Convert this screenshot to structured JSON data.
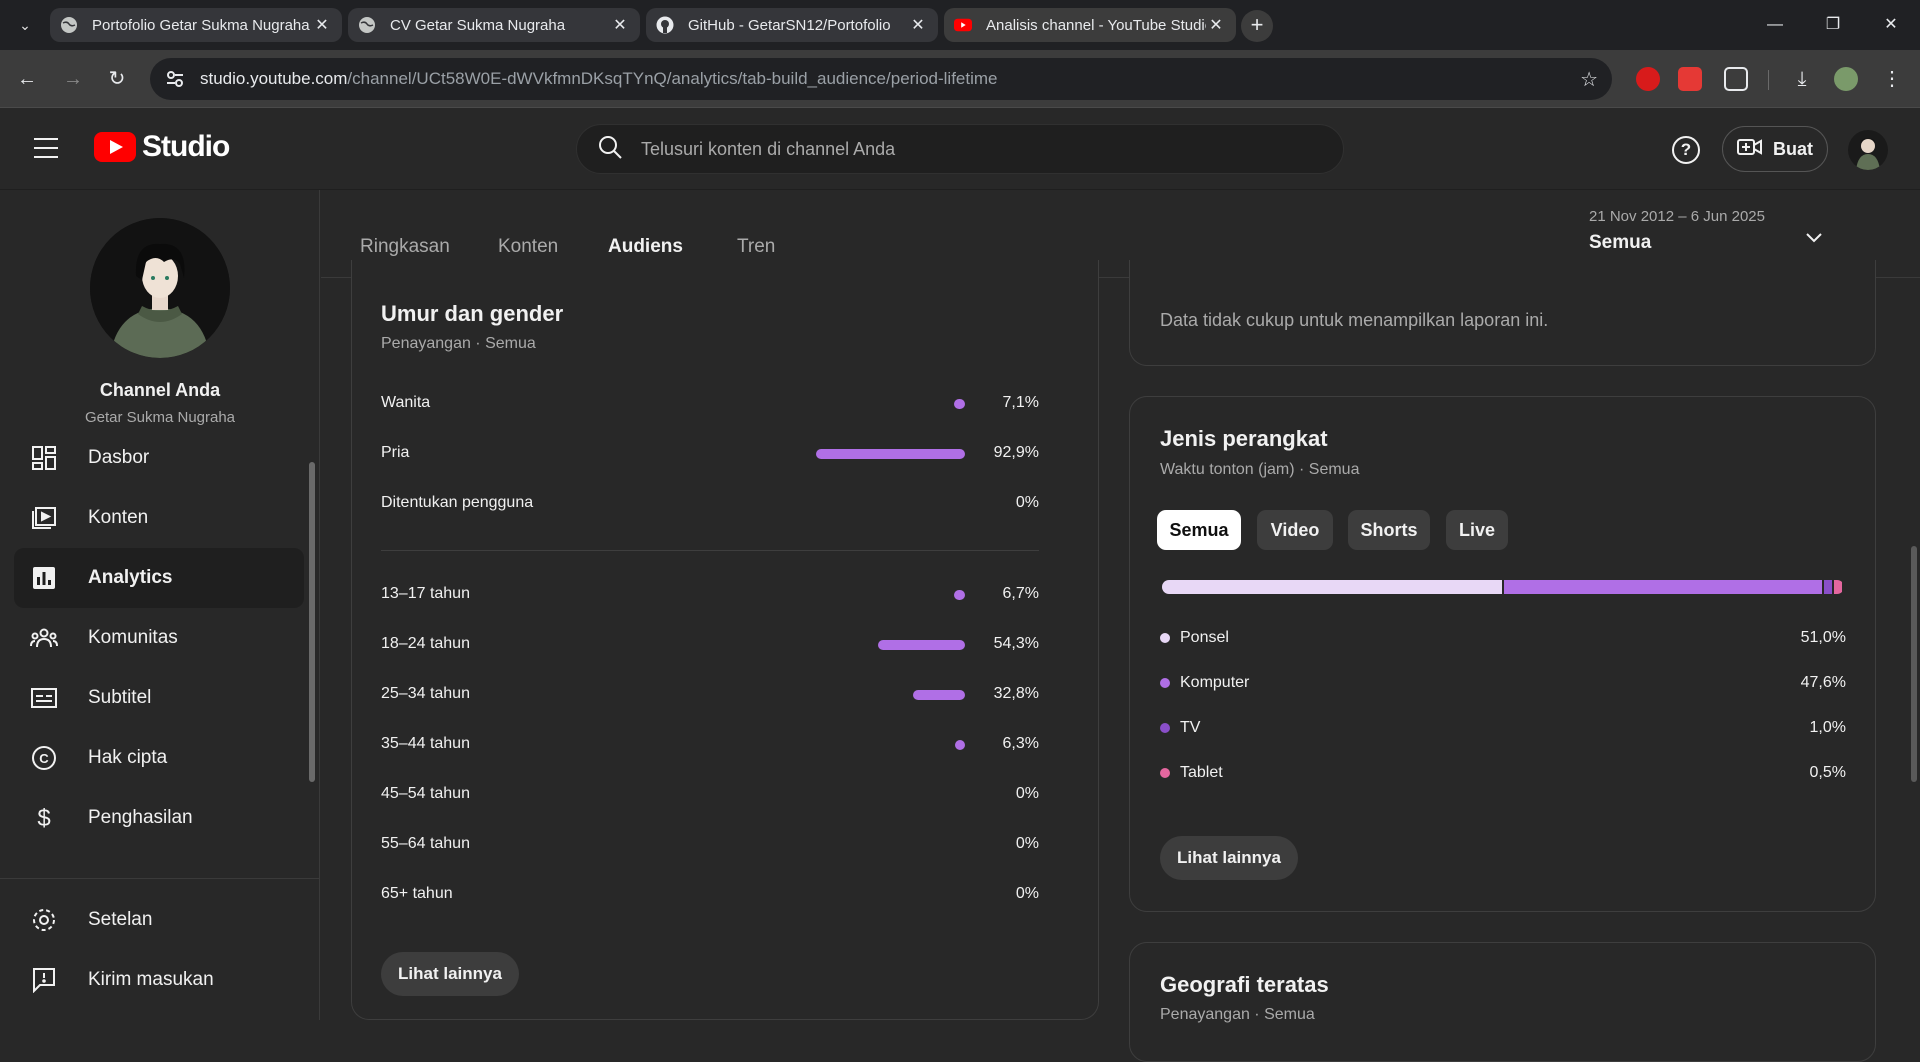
{
  "browser": {
    "tabs": [
      {
        "title": "Portofolio Getar Sukma Nugraha",
        "icon": "globe-icon"
      },
      {
        "title": "CV Getar Sukma Nugraha",
        "icon": "globe-icon"
      },
      {
        "title": "GitHub - GetarSN12/Portofolio",
        "icon": "github-icon"
      },
      {
        "title": "Analisis channel - YouTube Studio",
        "icon": "youtube-icon"
      }
    ],
    "url_host": "studio.youtube.com",
    "url_path": "/channel/UCt58W0E-dWVkfmnDKsqTYnQ/analytics/tab-build_audience/period-lifetime"
  },
  "header": {
    "logo_text": "Studio",
    "search_placeholder": "Telusuri konten di channel Anda",
    "create_label": "Buat"
  },
  "sidebar": {
    "channel_title": "Channel Anda",
    "channel_name": "Getar Sukma Nugraha",
    "items": [
      {
        "label": "Dasbor",
        "icon": "dashboard-icon"
      },
      {
        "label": "Konten",
        "icon": "content-icon"
      },
      {
        "label": "Analytics",
        "icon": "analytics-icon"
      },
      {
        "label": "Komunitas",
        "icon": "community-icon"
      },
      {
        "label": "Subtitel",
        "icon": "subtitles-icon"
      },
      {
        "label": "Hak cipta",
        "icon": "copyright-icon"
      },
      {
        "label": "Penghasilan",
        "icon": "earn-icon"
      },
      {
        "label": "Setelan",
        "icon": "settings-icon"
      },
      {
        "label": "Kirim masukan",
        "icon": "feedback-icon"
      }
    ],
    "active": "Analytics"
  },
  "analytics": {
    "tabs": [
      "Ringkasan",
      "Konten",
      "Audiens",
      "Tren"
    ],
    "active_tab": "Audiens",
    "date_range": "21 Nov 2012 – 6 Jun 2025",
    "date_range_value": "Semua"
  },
  "age_gender": {
    "title": "Umur dan gender",
    "subtitle": "Penayangan · Semua",
    "gender": [
      {
        "label": "Wanita",
        "value": "7,1%",
        "pct": 7.1
      },
      {
        "label": "Pria",
        "value": "92,9%",
        "pct": 92.9
      },
      {
        "label": "Ditentukan pengguna",
        "value": "0%",
        "pct": 0
      }
    ],
    "ages": [
      {
        "label": "13–17 tahun",
        "value": "6,7%",
        "pct": 6.7
      },
      {
        "label": "18–24 tahun",
        "value": "54,3%",
        "pct": 54.3
      },
      {
        "label": "25–34 tahun",
        "value": "32,8%",
        "pct": 32.8
      },
      {
        "label": "35–44 tahun",
        "value": "6,3%",
        "pct": 6.3
      },
      {
        "label": "45–54 tahun",
        "value": "0%",
        "pct": 0
      },
      {
        "label": "55–64 tahun",
        "value": "0%",
        "pct": 0
      },
      {
        "label": "65+ tahun",
        "value": "0%",
        "pct": 0
      }
    ],
    "more_label": "Lihat lainnya"
  },
  "insufficient": {
    "message": "Data tidak cukup untuk menampilkan laporan ini."
  },
  "device": {
    "title": "Jenis perangkat",
    "subtitle": "Waktu tonton (jam) · Semua",
    "chips": [
      "Semua",
      "Video",
      "Shorts",
      "Live"
    ],
    "active_chip": "Semua",
    "rows": [
      {
        "label": "Ponsel",
        "value": "51,0%",
        "pct": 51.0,
        "color": "#e8d8f6"
      },
      {
        "label": "Komputer",
        "value": "47,6%",
        "pct": 47.6,
        "color": "#b06fe6"
      },
      {
        "label": "TV",
        "value": "1,0%",
        "pct": 1.0,
        "color": "#8a4fc9"
      },
      {
        "label": "Tablet",
        "value": "0,5%",
        "pct": 0.5,
        "color": "#e4679f"
      }
    ],
    "more_label": "Lihat lainnya"
  },
  "geo": {
    "title": "Geografi teratas",
    "subtitle": "Penayangan · Semua"
  },
  "colors": {
    "bar": "#b06fe6",
    "accent_red": "#ff0000"
  }
}
